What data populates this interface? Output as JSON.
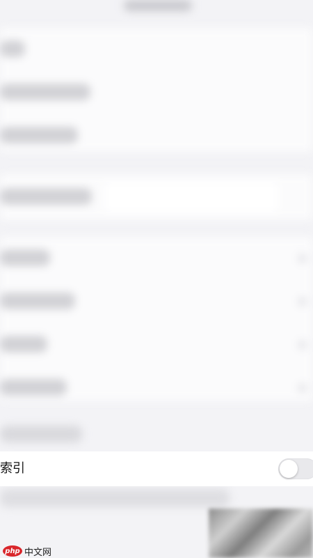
{
  "toggle_row": {
    "label": "索引",
    "enabled": false
  },
  "watermark": {
    "logo": "php",
    "text": "中文网"
  }
}
